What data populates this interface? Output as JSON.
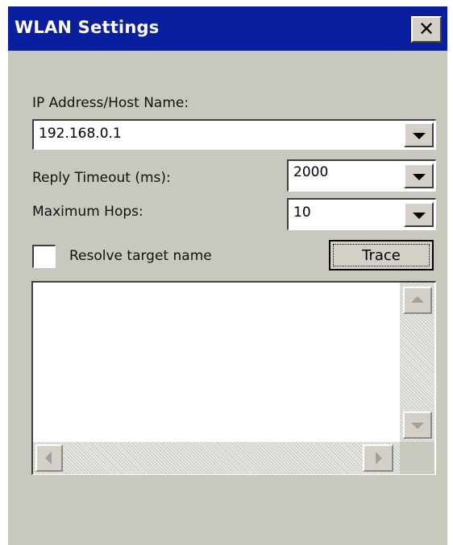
{
  "window": {
    "title": "WLAN Settings",
    "close_symbol": "✕",
    "colors": {
      "titlebar": "#0a1f9e",
      "body": "#c8c8bf"
    }
  },
  "ip_address": {
    "label": "IP Address/Host Name:",
    "value": "192.168.0.1"
  },
  "reply_timeout": {
    "label": "Reply Timeout (ms):",
    "value": "2000"
  },
  "maximum_hops": {
    "label": "Maximum Hops:",
    "value": "10"
  },
  "resolve_target": {
    "label": "Resolve target name",
    "checked": false
  },
  "trace_button": {
    "label": "Trace"
  },
  "output": {
    "text": ""
  },
  "icons": {
    "close": "close-icon",
    "dropdown": "chevron-down-icon",
    "scroll_up": "scroll-up-arrow-icon",
    "scroll_down": "scroll-down-arrow-icon",
    "scroll_left": "scroll-left-arrow-icon",
    "scroll_right": "scroll-right-arrow-icon"
  }
}
